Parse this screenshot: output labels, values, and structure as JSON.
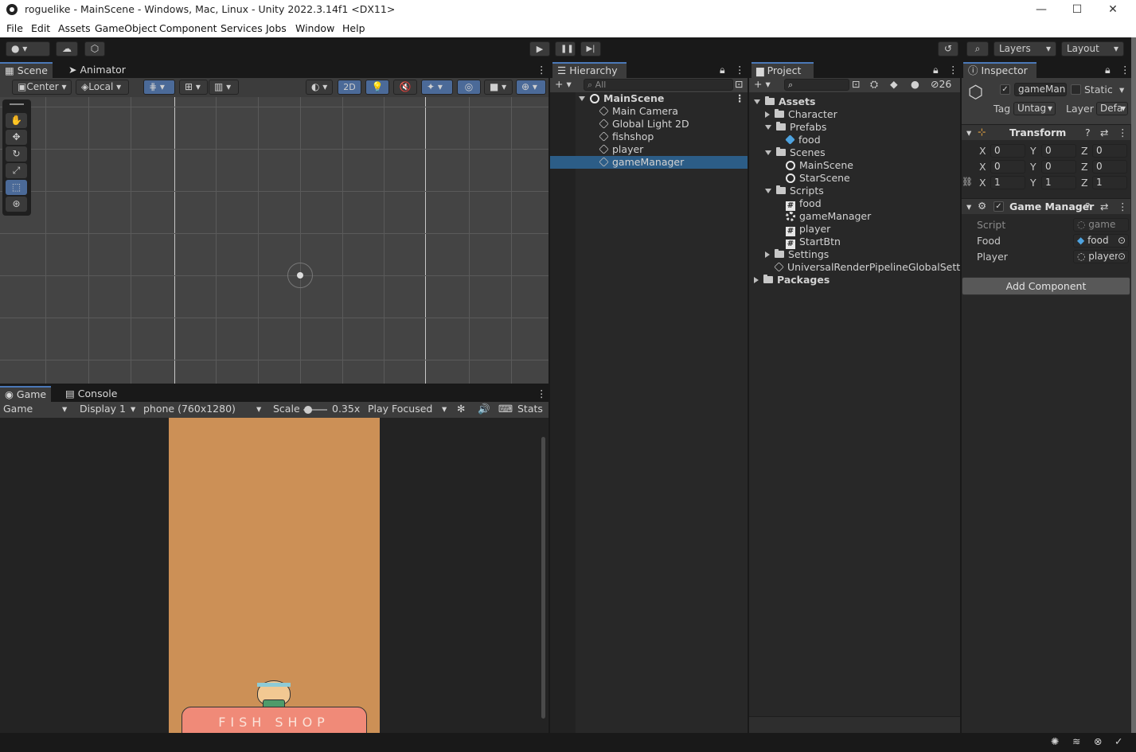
{
  "window": {
    "title": "roguelike - MainScene - Windows, Mac, Linux - Unity 2022.3.14f1 <DX11>",
    "minimize": "—",
    "maximize": "☐",
    "close": "✕"
  },
  "menu": [
    "File",
    "Edit",
    "Assets",
    "GameObject",
    "Component",
    "Services",
    "Jobs",
    "Window",
    "Help"
  ],
  "toolbar": {
    "layers": "Layers",
    "layout": "Layout"
  },
  "scene": {
    "tabs": [
      "Scene",
      "Animator"
    ],
    "pivot": "Center",
    "space": "Local",
    "mode_2d": "2D"
  },
  "game": {
    "tabs": [
      "Game",
      "Console"
    ],
    "view": "Game",
    "display": "Display 1",
    "resolution": "phone (760x1280)",
    "scale_label": "Scale",
    "scale_value": "0.35x",
    "play_mode": "Play Focused",
    "stats": "Stats",
    "sign_text": "FISH  SHOP"
  },
  "hierarchy": {
    "tab": "Hierarchy",
    "search_placeholder": "All",
    "scene": "MainScene",
    "items": [
      "Main Camera",
      "Global Light 2D",
      "fishshop",
      "player",
      "gameManager"
    ],
    "selected": "gameManager"
  },
  "project": {
    "tab": "Project",
    "count": "26",
    "tree": [
      {
        "label": "Assets",
        "depth": 0,
        "icon": "folder",
        "open": true,
        "bold": true
      },
      {
        "label": "Character",
        "depth": 1,
        "icon": "folder",
        "open": false
      },
      {
        "label": "Prefabs",
        "depth": 1,
        "icon": "folder",
        "open": true
      },
      {
        "label": "food",
        "depth": 2,
        "icon": "prefab"
      },
      {
        "label": "Scenes",
        "depth": 1,
        "icon": "folder",
        "open": true
      },
      {
        "label": "MainScene",
        "depth": 2,
        "icon": "unity"
      },
      {
        "label": "StarScene",
        "depth": 2,
        "icon": "unity"
      },
      {
        "label": "Scripts",
        "depth": 1,
        "icon": "folder",
        "open": true
      },
      {
        "label": "food",
        "depth": 2,
        "icon": "hash"
      },
      {
        "label": "gameManager",
        "depth": 2,
        "icon": "gear"
      },
      {
        "label": "player",
        "depth": 2,
        "icon": "hash"
      },
      {
        "label": "StartBtn",
        "depth": 2,
        "icon": "hash"
      },
      {
        "label": "Settings",
        "depth": 1,
        "icon": "folder",
        "open": false
      },
      {
        "label": "UniversalRenderPipelineGlobalSettings",
        "depth": 1,
        "icon": "asset"
      },
      {
        "label": "Packages",
        "depth": 0,
        "icon": "folder",
        "open": false,
        "bold": true
      }
    ]
  },
  "inspector": {
    "tab": "Inspector",
    "object_name": "gameMan",
    "static_label": "Static",
    "tag_label": "Tag",
    "tag_value": "Untag",
    "layer_label": "Layer",
    "layer_value": "Defa",
    "transform": {
      "title": "Transform",
      "rows": [
        {
          "x": "0",
          "y": "0",
          "z": "0"
        },
        {
          "x": "0",
          "y": "0",
          "z": "0"
        },
        {
          "x": "1",
          "y": "1",
          "z": "1"
        }
      ]
    },
    "game_manager": {
      "title": "Game Manager",
      "script_label": "Script",
      "script_value": "game",
      "food_label": "Food",
      "food_value": "food",
      "player_label": "Player",
      "player_value": "player"
    },
    "add_component": "Add Component"
  },
  "colors": {
    "accent": "#2c5d87",
    "game_bg": "#cc9056",
    "sign": "#f08a78"
  }
}
